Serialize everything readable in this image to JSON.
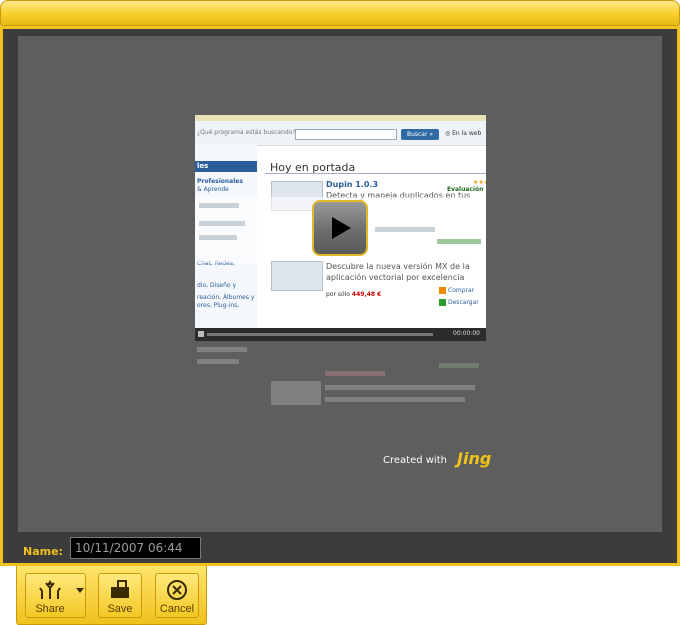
{
  "name_field": {
    "label": "Name:",
    "value": "10/11/2007 06:44"
  },
  "toolbar": {
    "share_label": "Share",
    "save_label": "Save",
    "cancel_label": "Cancel"
  },
  "watermark": {
    "created_with": "Created with",
    "brand": "Jing"
  },
  "thumbnail": {
    "search_label": "¿Qué programa estás buscando?",
    "search_button": "Buscar »",
    "web_label": "◎ En la web",
    "sidebar_heading": "les",
    "sidebar_items": [
      "Profesionales",
      "& Aprende",
      "Chat, Redes,",
      "dio, Diseño y",
      "reación, Álbumes y",
      "ores, Plug-ins,"
    ],
    "heading": "Hoy en portada",
    "app_title": "Dupin 1.0.3",
    "app_desc_line1": "Detecta y maneja duplicados en tus",
    "stars": "★★★★☆",
    "eval_label": "Evaluación",
    "desc2_line1": "Descubre la nueva versión MX de la",
    "desc2_line2": "aplicación vectorial por excelencia",
    "price_label": "por sólo",
    "price_value": "449,48 €",
    "link_buy": "Comprar",
    "link_download": "Descargar",
    "player_time": "00:00:00"
  }
}
